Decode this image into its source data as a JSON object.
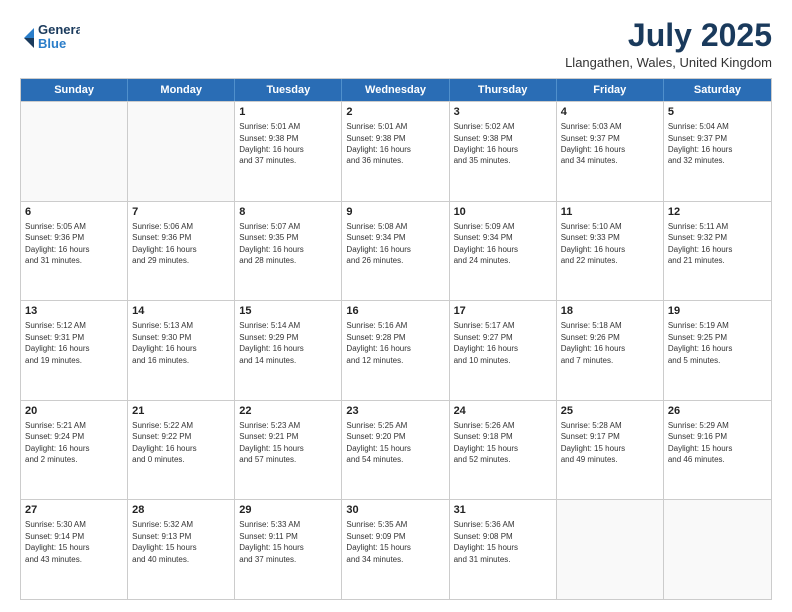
{
  "header": {
    "logo": {
      "line1": "General",
      "line2": "Blue"
    },
    "title": "July 2025",
    "location": "Llangathen, Wales, United Kingdom"
  },
  "weekdays": [
    "Sunday",
    "Monday",
    "Tuesday",
    "Wednesday",
    "Thursday",
    "Friday",
    "Saturday"
  ],
  "weeks": [
    [
      {
        "day": "",
        "info": ""
      },
      {
        "day": "",
        "info": ""
      },
      {
        "day": "1",
        "info": "Sunrise: 5:01 AM\nSunset: 9:38 PM\nDaylight: 16 hours\nand 37 minutes."
      },
      {
        "day": "2",
        "info": "Sunrise: 5:01 AM\nSunset: 9:38 PM\nDaylight: 16 hours\nand 36 minutes."
      },
      {
        "day": "3",
        "info": "Sunrise: 5:02 AM\nSunset: 9:38 PM\nDaylight: 16 hours\nand 35 minutes."
      },
      {
        "day": "4",
        "info": "Sunrise: 5:03 AM\nSunset: 9:37 PM\nDaylight: 16 hours\nand 34 minutes."
      },
      {
        "day": "5",
        "info": "Sunrise: 5:04 AM\nSunset: 9:37 PM\nDaylight: 16 hours\nand 32 minutes."
      }
    ],
    [
      {
        "day": "6",
        "info": "Sunrise: 5:05 AM\nSunset: 9:36 PM\nDaylight: 16 hours\nand 31 minutes."
      },
      {
        "day": "7",
        "info": "Sunrise: 5:06 AM\nSunset: 9:36 PM\nDaylight: 16 hours\nand 29 minutes."
      },
      {
        "day": "8",
        "info": "Sunrise: 5:07 AM\nSunset: 9:35 PM\nDaylight: 16 hours\nand 28 minutes."
      },
      {
        "day": "9",
        "info": "Sunrise: 5:08 AM\nSunset: 9:34 PM\nDaylight: 16 hours\nand 26 minutes."
      },
      {
        "day": "10",
        "info": "Sunrise: 5:09 AM\nSunset: 9:34 PM\nDaylight: 16 hours\nand 24 minutes."
      },
      {
        "day": "11",
        "info": "Sunrise: 5:10 AM\nSunset: 9:33 PM\nDaylight: 16 hours\nand 22 minutes."
      },
      {
        "day": "12",
        "info": "Sunrise: 5:11 AM\nSunset: 9:32 PM\nDaylight: 16 hours\nand 21 minutes."
      }
    ],
    [
      {
        "day": "13",
        "info": "Sunrise: 5:12 AM\nSunset: 9:31 PM\nDaylight: 16 hours\nand 19 minutes."
      },
      {
        "day": "14",
        "info": "Sunrise: 5:13 AM\nSunset: 9:30 PM\nDaylight: 16 hours\nand 16 minutes."
      },
      {
        "day": "15",
        "info": "Sunrise: 5:14 AM\nSunset: 9:29 PM\nDaylight: 16 hours\nand 14 minutes."
      },
      {
        "day": "16",
        "info": "Sunrise: 5:16 AM\nSunset: 9:28 PM\nDaylight: 16 hours\nand 12 minutes."
      },
      {
        "day": "17",
        "info": "Sunrise: 5:17 AM\nSunset: 9:27 PM\nDaylight: 16 hours\nand 10 minutes."
      },
      {
        "day": "18",
        "info": "Sunrise: 5:18 AM\nSunset: 9:26 PM\nDaylight: 16 hours\nand 7 minutes."
      },
      {
        "day": "19",
        "info": "Sunrise: 5:19 AM\nSunset: 9:25 PM\nDaylight: 16 hours\nand 5 minutes."
      }
    ],
    [
      {
        "day": "20",
        "info": "Sunrise: 5:21 AM\nSunset: 9:24 PM\nDaylight: 16 hours\nand 2 minutes."
      },
      {
        "day": "21",
        "info": "Sunrise: 5:22 AM\nSunset: 9:22 PM\nDaylight: 16 hours\nand 0 minutes."
      },
      {
        "day": "22",
        "info": "Sunrise: 5:23 AM\nSunset: 9:21 PM\nDaylight: 15 hours\nand 57 minutes."
      },
      {
        "day": "23",
        "info": "Sunrise: 5:25 AM\nSunset: 9:20 PM\nDaylight: 15 hours\nand 54 minutes."
      },
      {
        "day": "24",
        "info": "Sunrise: 5:26 AM\nSunset: 9:18 PM\nDaylight: 15 hours\nand 52 minutes."
      },
      {
        "day": "25",
        "info": "Sunrise: 5:28 AM\nSunset: 9:17 PM\nDaylight: 15 hours\nand 49 minutes."
      },
      {
        "day": "26",
        "info": "Sunrise: 5:29 AM\nSunset: 9:16 PM\nDaylight: 15 hours\nand 46 minutes."
      }
    ],
    [
      {
        "day": "27",
        "info": "Sunrise: 5:30 AM\nSunset: 9:14 PM\nDaylight: 15 hours\nand 43 minutes."
      },
      {
        "day": "28",
        "info": "Sunrise: 5:32 AM\nSunset: 9:13 PM\nDaylight: 15 hours\nand 40 minutes."
      },
      {
        "day": "29",
        "info": "Sunrise: 5:33 AM\nSunset: 9:11 PM\nDaylight: 15 hours\nand 37 minutes."
      },
      {
        "day": "30",
        "info": "Sunrise: 5:35 AM\nSunset: 9:09 PM\nDaylight: 15 hours\nand 34 minutes."
      },
      {
        "day": "31",
        "info": "Sunrise: 5:36 AM\nSunset: 9:08 PM\nDaylight: 15 hours\nand 31 minutes."
      },
      {
        "day": "",
        "info": ""
      },
      {
        "day": "",
        "info": ""
      }
    ]
  ]
}
